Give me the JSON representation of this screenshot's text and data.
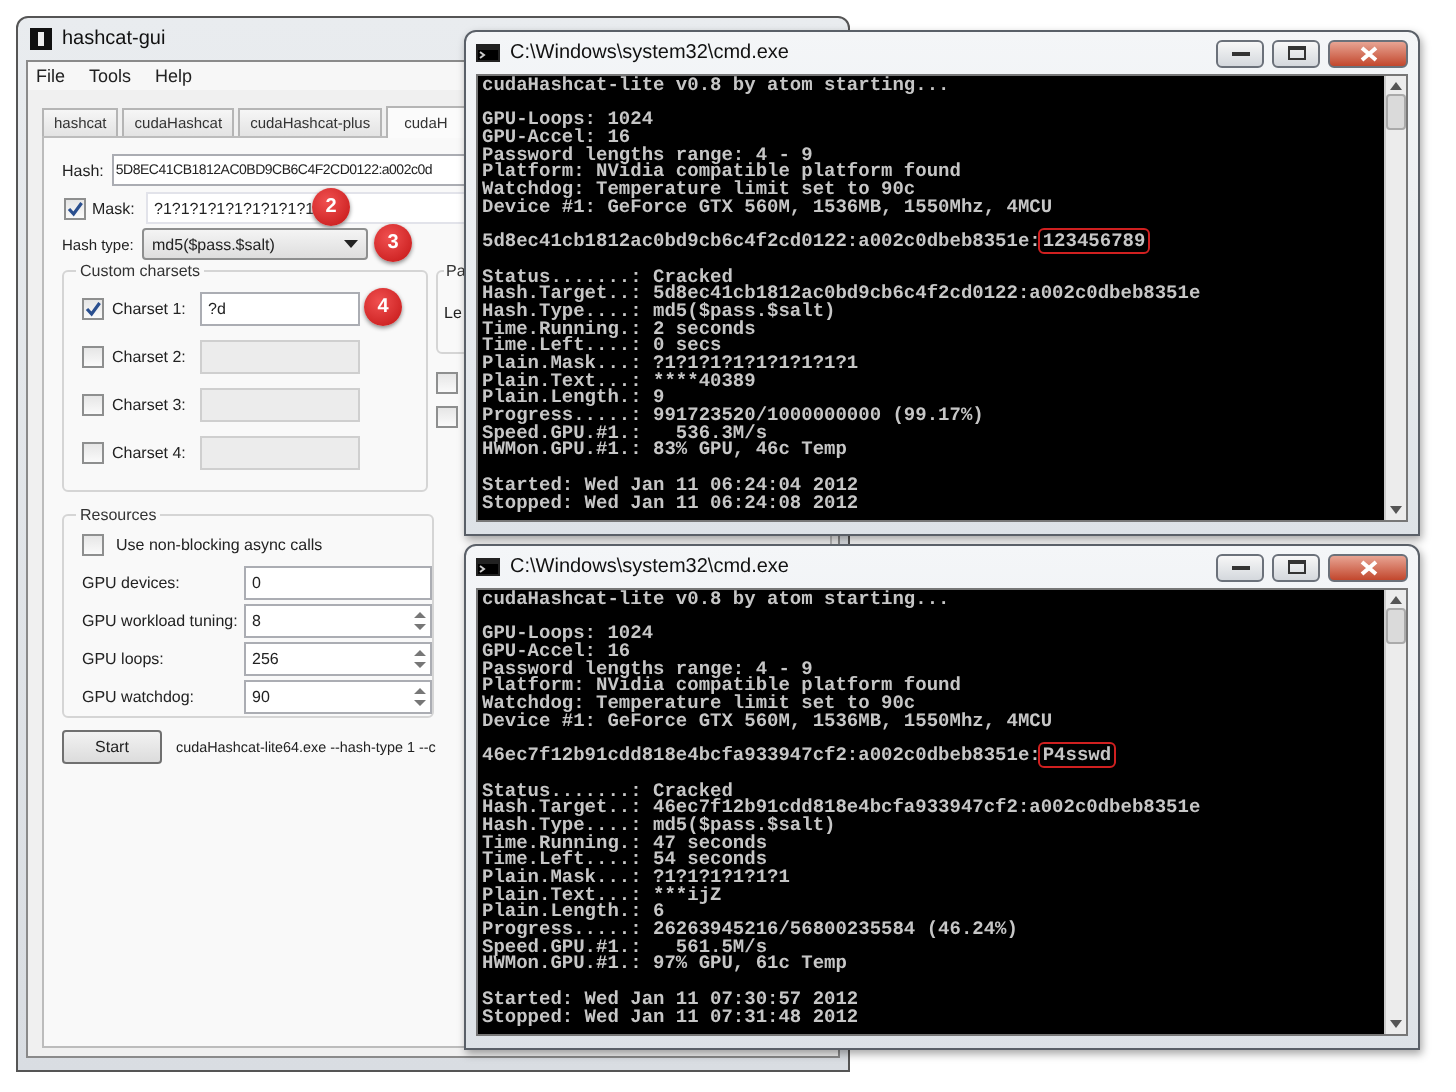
{
  "gui": {
    "title": "hashcat-gui",
    "menu": [
      "File",
      "Tools",
      "Help"
    ],
    "tabs": [
      {
        "label": "hashcat",
        "selected": false
      },
      {
        "label": "cudaHashcat",
        "selected": false
      },
      {
        "label": "cudaHashcat-plus",
        "selected": false
      },
      {
        "label": "cudaH",
        "selected": true
      }
    ],
    "hash": {
      "label": "Hash:",
      "value": "5D8EC41CB1812AC0BD9CB6C4F2CD0122:a002c0d"
    },
    "mask": {
      "label": "Mask:",
      "checked": true,
      "value": "?1?1?1?1?1?1?1?1?1",
      "callout": "2"
    },
    "hash_type": {
      "label": "Hash type:",
      "value": "md5($pass.$salt)",
      "callout": "3"
    },
    "custom_charsets": {
      "title": "Custom charsets",
      "charsets": [
        {
          "label": "Charset 1:",
          "checked": true,
          "disabled": false,
          "value": "?d",
          "callout": "4"
        },
        {
          "label": "Charset 2:",
          "checked": false,
          "disabled": true
        },
        {
          "label": "Charset 3:",
          "checked": false,
          "disabled": true
        },
        {
          "label": "Charset 4:",
          "checked": false,
          "disabled": true
        }
      ]
    },
    "side_group": {
      "title": "Pa",
      "label": "Le"
    },
    "side_checkboxes": [
      {
        "checked": false
      },
      {
        "checked": false
      }
    ],
    "resources": {
      "title": "Resources",
      "async": {
        "label": "Use non-blocking async calls",
        "checked": false
      },
      "fields": [
        {
          "kind": "text",
          "label": "GPU devices:",
          "value": "0"
        },
        {
          "kind": "spin",
          "label": "GPU workload tuning:",
          "value": "8"
        },
        {
          "kind": "spin",
          "label": "GPU loops:",
          "value": "256"
        },
        {
          "kind": "spin",
          "label": "GPU watchdog:",
          "value": "90"
        }
      ]
    },
    "start": {
      "label": "Start",
      "command": "cudaHashcat-lite64.exe --hash-type 1 --c"
    }
  },
  "consoles": [
    {
      "title": "C:\\Windows\\system32\\cmd.exe",
      "blocks": [
        {
          "kind": "lines",
          "lines": [
            "cudaHashcat-lite v0.8 by atom starting..."
          ]
        },
        {
          "kind": "lines",
          "lines": [
            "GPU-Loops: 1024",
            "GPU-Accel: 16",
            "Password lengths range: 4 - 9",
            "Platform: NVidia compatible platform found",
            "Watchdog: Temperature limit set to 90c",
            "Device #1: GeForce GTX 560M, 1536MB, 1550Mhz, 4MCU"
          ]
        },
        {
          "kind": "result",
          "hash": "5d8ec41cb1812ac0bd9cb6c4f2cd0122:a002c0dbeb8351e:",
          "password": "123456789"
        },
        {
          "kind": "lines",
          "lines": [
            "Status.......: Cracked",
            "Hash.Target..: 5d8ec41cb1812ac0bd9cb6c4f2cd0122:a002c0dbeb8351e",
            "Hash.Type....: md5($pass.$salt)",
            "Time.Running.: 2 seconds",
            "Time.Left....: 0 secs",
            "Plain.Mask...: ?1?1?1?1?1?1?1?1?1",
            "Plain.Text...: ****40389",
            "Plain.Length.: 9",
            "Progress.....: 991723520/1000000000 (99.17%)",
            "Speed.GPU.#1.:   536.3M/s",
            "HWMon.GPU.#1.: 83% GPU, 46c Temp"
          ]
        },
        {
          "kind": "lines",
          "lines": [
            "Started: Wed Jan 11 06:24:04 2012",
            "Stopped: Wed Jan 11 06:24:08 2012"
          ]
        }
      ]
    },
    {
      "title": "C:\\Windows\\system32\\cmd.exe",
      "blocks": [
        {
          "kind": "lines",
          "lines": [
            "cudaHashcat-lite v0.8 by atom starting..."
          ]
        },
        {
          "kind": "lines",
          "lines": [
            "GPU-Loops: 1024",
            "GPU-Accel: 16",
            "Password lengths range: 4 - 9",
            "Platform: NVidia compatible platform found",
            "Watchdog: Temperature limit set to 90c",
            "Device #1: GeForce GTX 560M, 1536MB, 1550Mhz, 4MCU"
          ]
        },
        {
          "kind": "result",
          "hash": "46ec7f12b91cdd818e4bcfa933947cf2:a002c0dbeb8351e:",
          "password": "P4sswd"
        },
        {
          "kind": "lines",
          "lines": [
            "Status.......: Cracked",
            "Hash.Target..: 46ec7f12b91cdd818e4bcfa933947cf2:a002c0dbeb8351e",
            "Hash.Type....: md5($pass.$salt)",
            "Time.Running.: 47 seconds",
            "Time.Left....: 54 seconds",
            "Plain.Mask...: ?1?1?1?1?1?1",
            "Plain.Text...: ***ijZ",
            "Plain.Length.: 6",
            "Progress.....: 26263945216/56800235584 (46.24%)",
            "Speed.GPU.#1.:   561.5M/s",
            "HWMon.GPU.#1.: 97% GPU, 61c Temp"
          ]
        },
        {
          "kind": "lines",
          "lines": [
            "Started: Wed Jan 11 07:30:57 2012",
            "Stopped: Wed Jan 11 07:31:48 2012"
          ]
        }
      ]
    }
  ]
}
